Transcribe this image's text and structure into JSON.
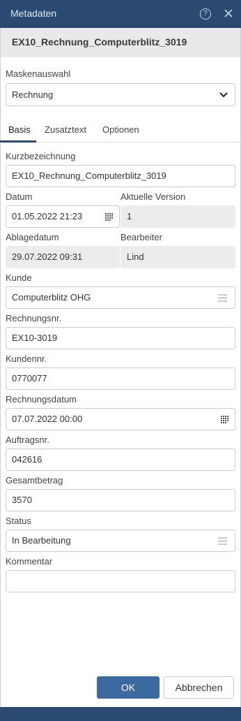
{
  "window": {
    "title": "Metadaten",
    "help_icon": "help-circle-icon",
    "close_icon": "close-icon"
  },
  "document_title": "EX10_Rechnung_Computerblitz_3019",
  "mask": {
    "label": "Maskenauswahl",
    "value": "Rechnung"
  },
  "tabs": [
    {
      "label": "Basis"
    },
    {
      "label": "Zusatztext"
    },
    {
      "label": "Optionen"
    }
  ],
  "fields": {
    "kurzbezeichnung": {
      "label": "Kurzbezeichnung",
      "value": "EX10_Rechnung_Computerblitz_3019"
    },
    "datum": {
      "label": "Datum",
      "value": "01.05.2022 21:23"
    },
    "aktuelle_version": {
      "label": "Aktuelle Version",
      "value": "1"
    },
    "ablagedatum": {
      "label": "Ablagedatum",
      "value": "29.07.2022 09:31"
    },
    "bearbeiter": {
      "label": "Bearbeiter",
      "value": "Lind"
    },
    "kunde": {
      "label": "Kunde",
      "value": "Computerblitz OHG"
    },
    "rechnungsnr": {
      "label": "Rechnungsnr.",
      "value": "EX10-3019"
    },
    "kundennr": {
      "label": "Kundennr.",
      "value": "0770077"
    },
    "rechnungsdatum": {
      "label": "Rechnungsdatum",
      "value": "07.07.2022 00:00"
    },
    "auftragsnr": {
      "label": "Auftragsnr.",
      "value": "042616"
    },
    "gesamtbetrag": {
      "label": "Gesamtbetrag",
      "value": "3570"
    },
    "status": {
      "label": "Status",
      "value": "In Bearbeitung"
    },
    "kommentar": {
      "label": "Kommentar",
      "value": ""
    }
  },
  "buttons": {
    "ok": "OK",
    "cancel": "Abbrechen"
  },
  "colors": {
    "header": "#2b4a72",
    "primary_button": "#3d6a9e",
    "readonly_bg": "#ececec"
  }
}
